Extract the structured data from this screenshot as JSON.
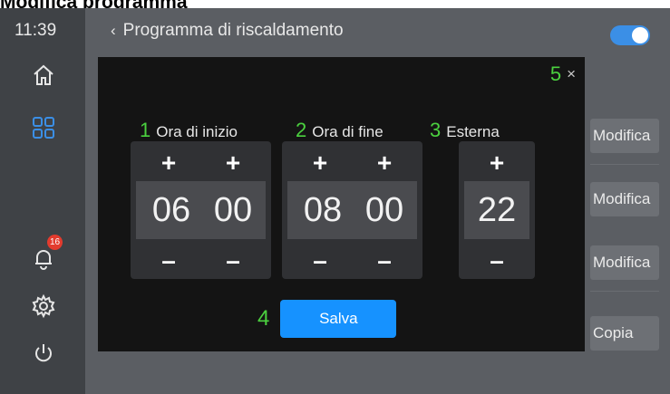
{
  "doc_title": "Modifica programma",
  "status": {
    "time": "11:39"
  },
  "header": {
    "back_icon": "chevron-left-icon",
    "title": "Programma di riscaldamento"
  },
  "sidebar": {
    "icons": [
      "home-icon",
      "grid-icon",
      "bell-icon",
      "gear-icon",
      "power-icon"
    ],
    "notification_count": "16"
  },
  "toggle": {
    "on": true,
    "color": "#3b8fe6"
  },
  "background_buttons": [
    "Modifica",
    "Modifica",
    "Modifica",
    "Copia"
  ],
  "modal": {
    "close_number": "5",
    "close_glyph": "×",
    "columns": [
      {
        "number": "1",
        "label": "Ora di inizio"
      },
      {
        "number": "2",
        "label": "Ora di fine"
      },
      {
        "number": "3",
        "label": "Esterna"
      }
    ],
    "start": {
      "hours": "06",
      "minutes": "00"
    },
    "end": {
      "hours": "08",
      "minutes": "00"
    },
    "external": {
      "value": "22"
    },
    "plus": "+",
    "minus": "–",
    "save_number": "4",
    "save_label": "Salva"
  },
  "colors": {
    "accent_blue": "#1692ff",
    "annotation_green": "#4bd13f",
    "badge_red": "#e33b2e"
  }
}
